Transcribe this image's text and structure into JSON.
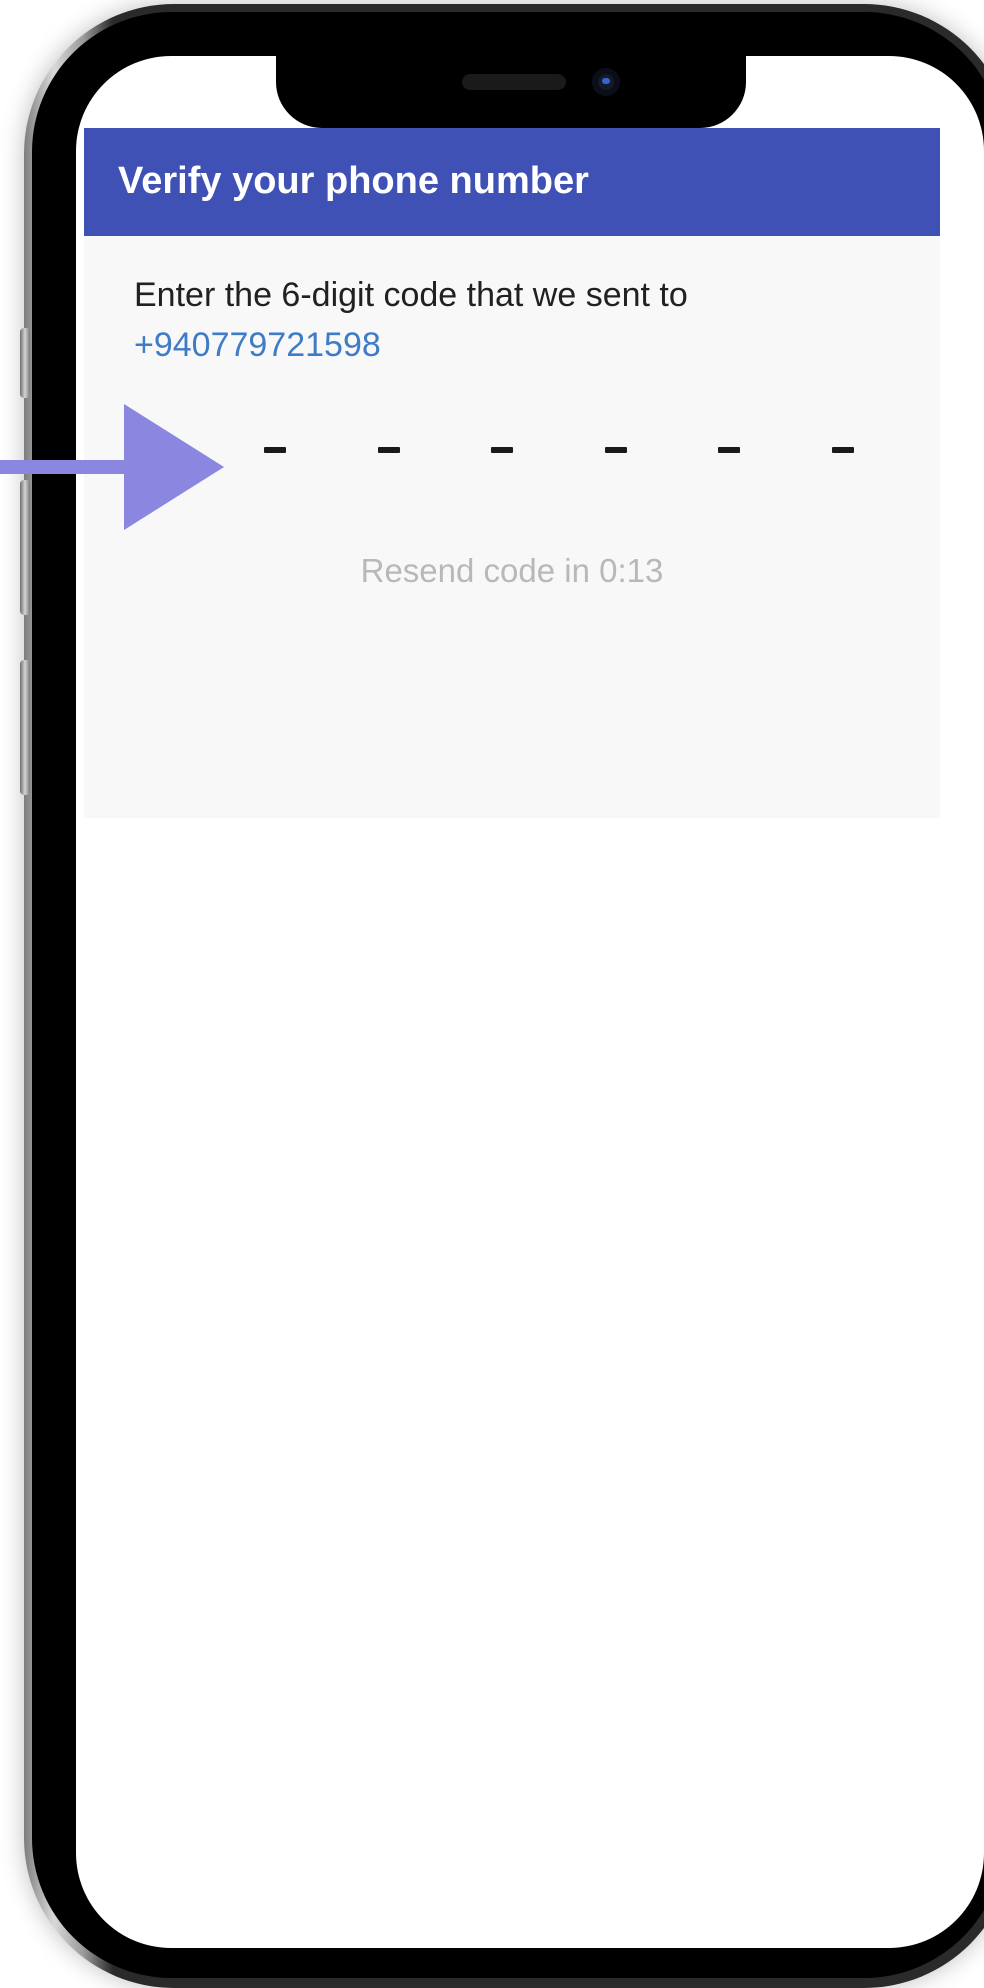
{
  "appbar": {
    "title": "Verify your phone number"
  },
  "verification": {
    "instruction": "Enter the 6-digit code that we sent to",
    "phone_number": "+940779721598",
    "code_slots": [
      "-",
      "-",
      "-",
      "-",
      "-",
      "-"
    ],
    "resend_text": "Resend code in 0:13"
  },
  "colors": {
    "appbar_background": "#3f51b5",
    "link": "#3f7cc7",
    "arrow": "#8b86e0"
  }
}
